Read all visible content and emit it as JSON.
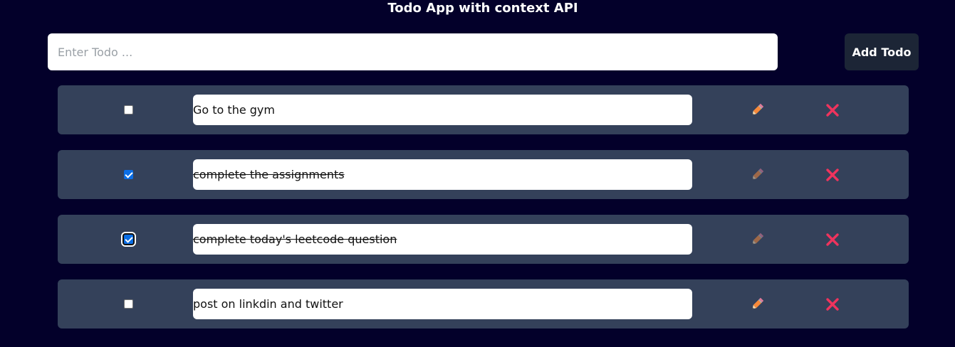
{
  "app": {
    "title": "Todo App with context API"
  },
  "form": {
    "placeholder": "Enter Todo ...",
    "value": "",
    "add_label": "Add Todo"
  },
  "todos": [
    {
      "text": "Go to the gym",
      "completed": false
    },
    {
      "text": "complete the assignments",
      "completed": true
    },
    {
      "text": "complete today's leetcode question",
      "completed": true,
      "focused": true
    },
    {
      "text": "post on linkdin and twitter",
      "completed": false
    }
  ],
  "icons": {
    "edit": "pencil-icon",
    "delete": "close-icon"
  },
  "colors": {
    "background": "#03002a",
    "card": "#34415a",
    "button": "#1c2536",
    "pencil": "#f6893a",
    "delete": "#f0335d",
    "checkbox_checked": "#0b6ee5"
  }
}
